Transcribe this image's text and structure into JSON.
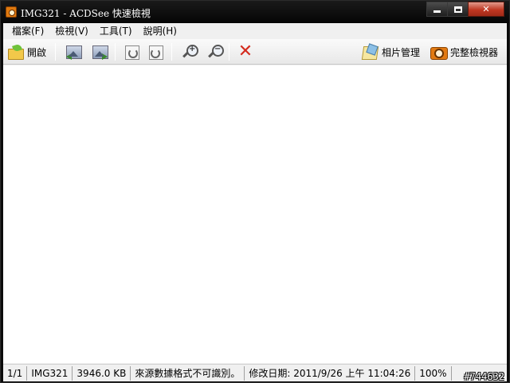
{
  "window": {
    "title": "IMG321 - ACDSee 快速檢視",
    "minimize_icon": "minimize-icon",
    "maximize_icon": "maximize-icon",
    "close_icon": "close-icon"
  },
  "menubar": {
    "items": [
      {
        "label": "檔案(F)"
      },
      {
        "label": "檢視(V)"
      },
      {
        "label": "工具(T)"
      },
      {
        "label": "說明(H)"
      }
    ]
  },
  "toolbar": {
    "open_label": "開啟",
    "photo_manager_label": "相片管理",
    "full_viewer_label": "完整檢視器",
    "icons": {
      "open": "folder-open-icon",
      "prev": "previous-image-icon",
      "next": "next-image-icon",
      "rotate_left": "rotate-left-icon",
      "rotate_right": "rotate-right-icon",
      "zoom_in": "zoom-in-icon",
      "zoom_out": "zoom-out-icon",
      "delete": "delete-icon",
      "photo_manager": "photo-album-icon",
      "full_viewer": "camera-icon"
    },
    "delete_color": "#d42b1e"
  },
  "statusbar": {
    "position": "1/1",
    "filename": "IMG321",
    "filesize": "3946.0 KB",
    "message": "來源數據格式不可識別。",
    "modified": "修改日期: 2011/9/26 上午 11:04:26",
    "zoom": "100%"
  },
  "watermark": "#744632"
}
